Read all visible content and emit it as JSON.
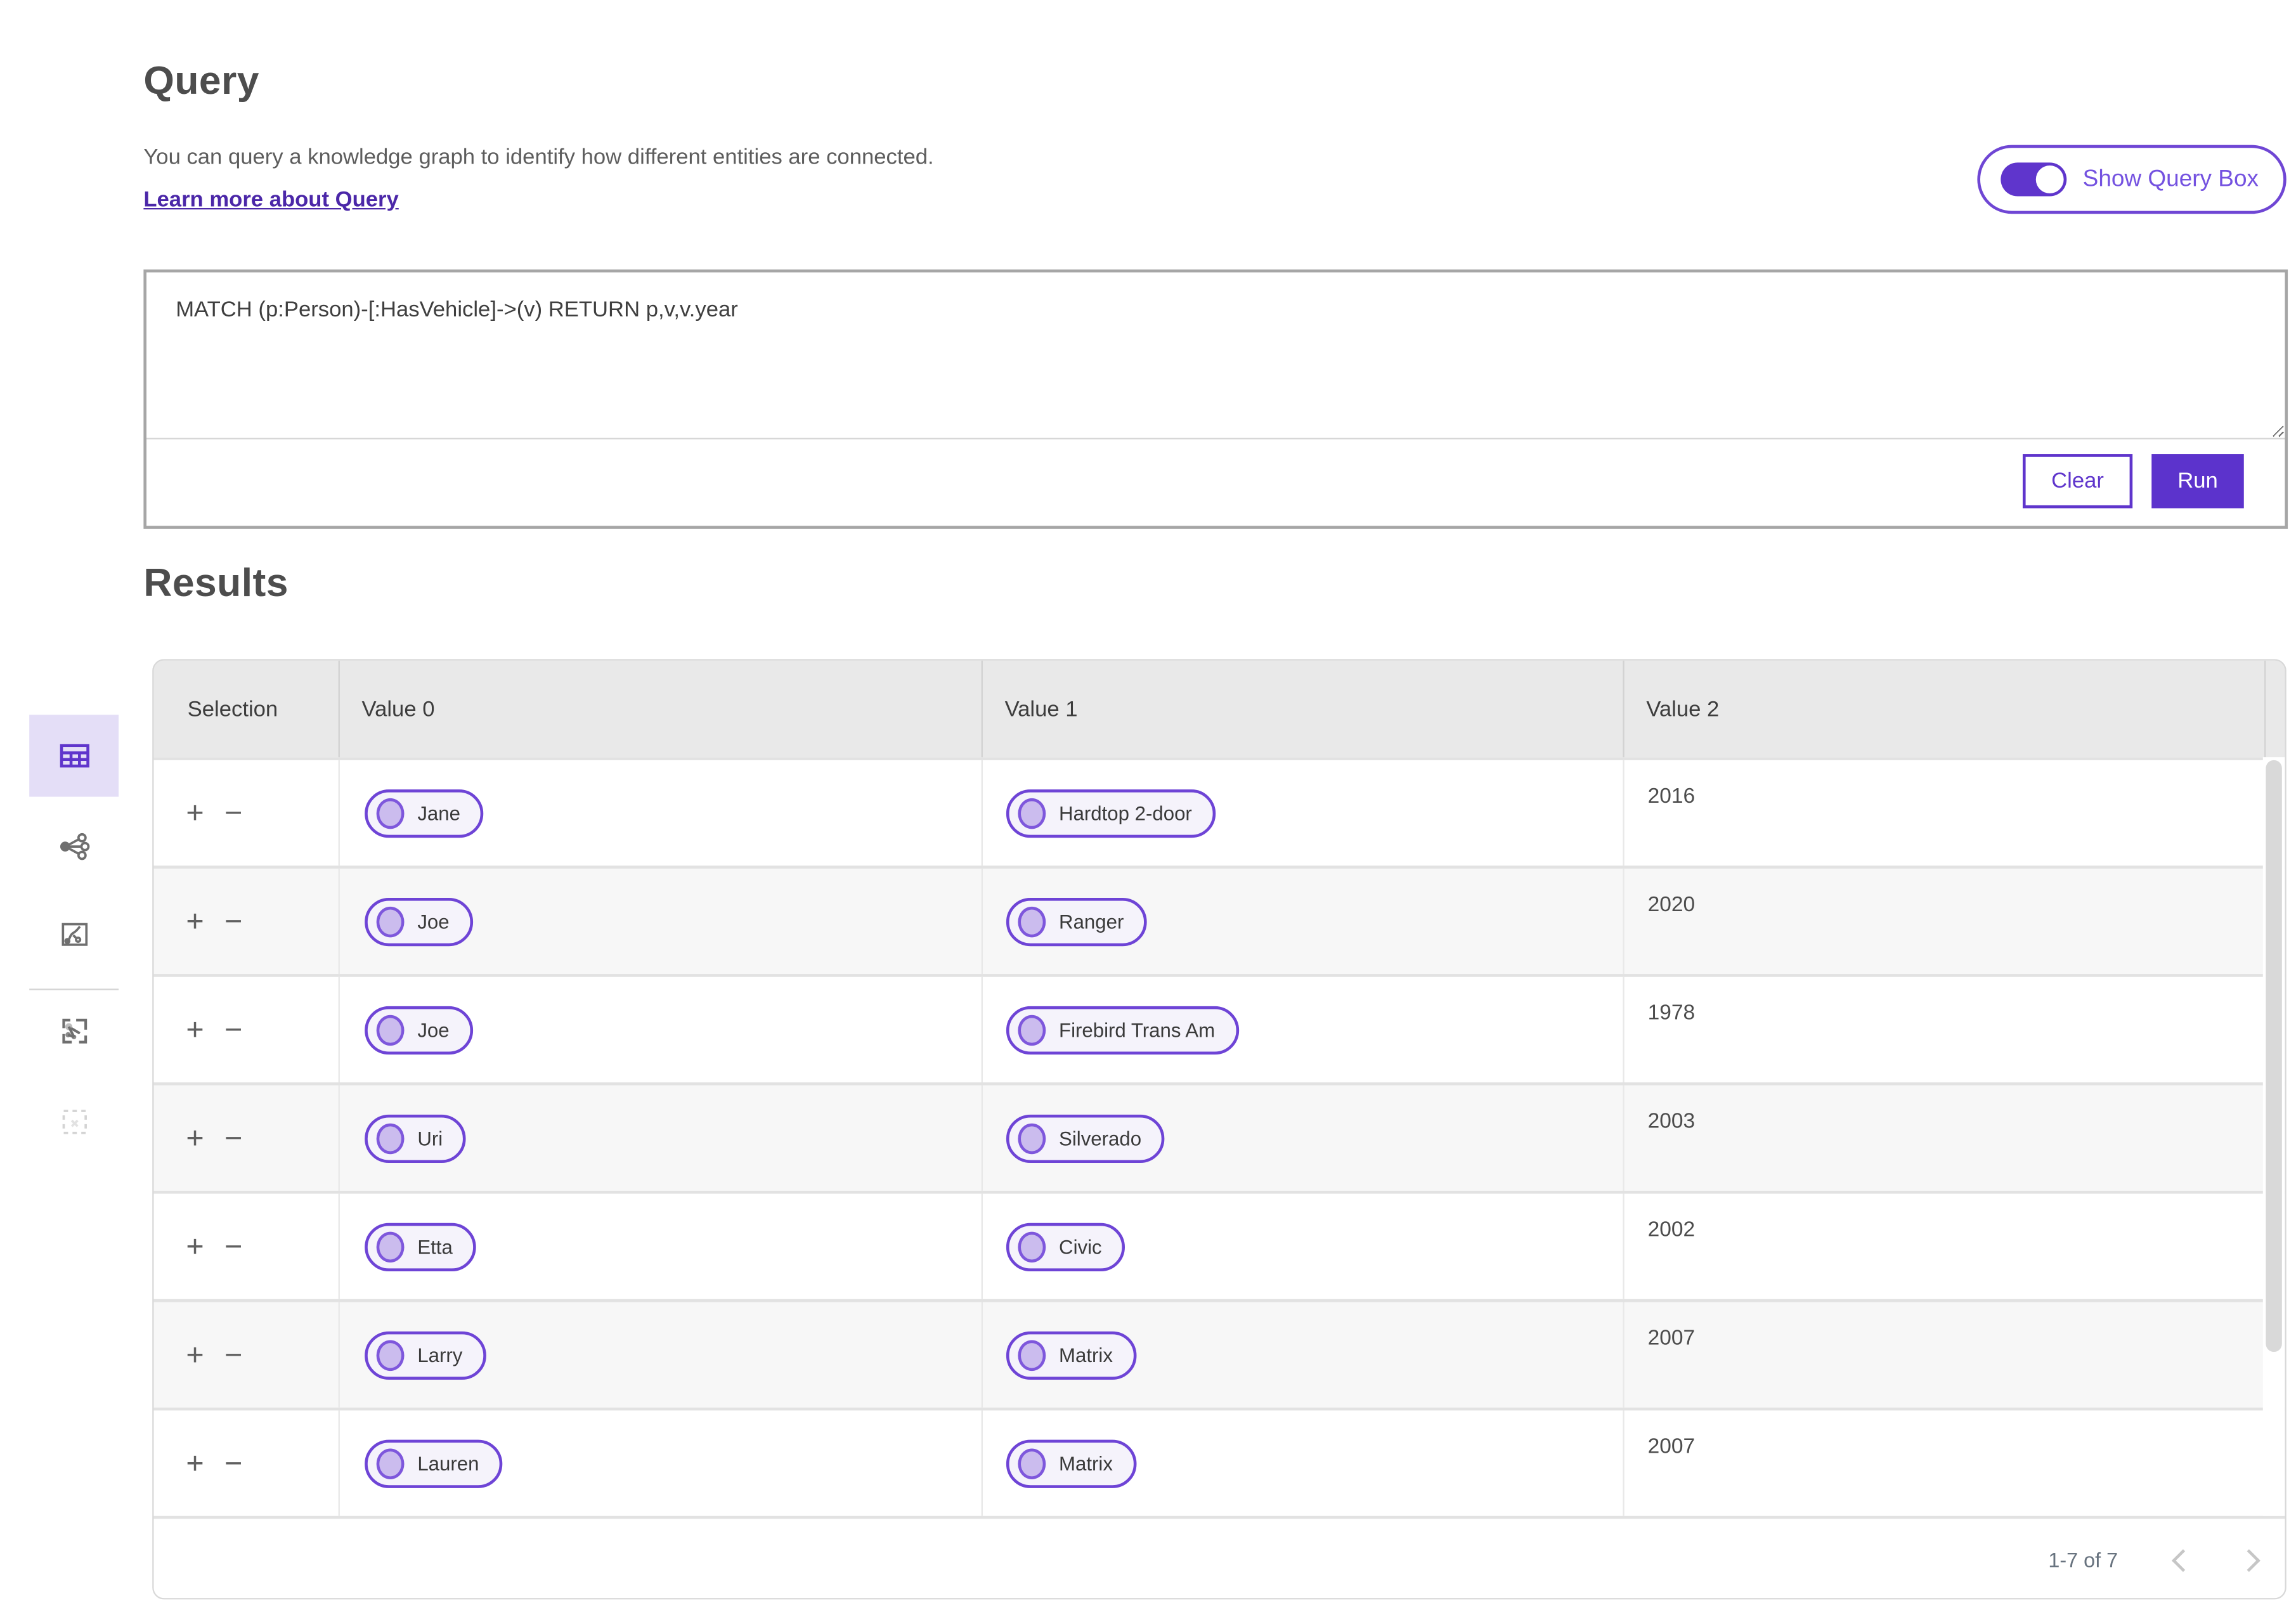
{
  "colors": {
    "accent_purple": "#5f35cc",
    "link_purple": "#4b27a8",
    "pill_border": "#6e44d6",
    "pill_fill": "#f5f3fb",
    "pill_dot_fill": "#cbbcee",
    "sidebar_selected_bg": "#e4def7",
    "table_header_gray": "#e9e9e9",
    "row_alt_gray": "#f7f7f7"
  },
  "query_section": {
    "title": "Query",
    "description": "You can query a knowledge graph to identify how different entities are connected.",
    "learn_more_link": "Learn more about Query",
    "show_query_box_label": "Show Query Box",
    "toggle_state": "on"
  },
  "query_box": {
    "query_text": "MATCH (p:Person)-[:HasVehicle]->(v) RETURN p,v,v.year",
    "clear_button": "Clear",
    "run_button": "Run"
  },
  "results_section": {
    "title": "Results",
    "columns": [
      "Selection",
      "Value 0",
      "Value 1",
      "Value 2"
    ],
    "row_actions": {
      "add": "+",
      "remove": "−"
    },
    "rows": [
      {
        "value0": "Jane",
        "value1": "Hardtop 2-door",
        "value2": "2016"
      },
      {
        "value0": "Joe",
        "value1": "Ranger",
        "value2": "2020"
      },
      {
        "value0": "Joe",
        "value1": "Firebird Trans Am",
        "value2": "1978"
      },
      {
        "value0": "Uri",
        "value1": "Silverado",
        "value2": "2003"
      },
      {
        "value0": "Etta",
        "value1": "Civic",
        "value2": "2002"
      },
      {
        "value0": "Larry",
        "value1": "Matrix",
        "value2": "2007"
      },
      {
        "value0": "Lauren",
        "value1": "Matrix",
        "value2": "2007"
      }
    ],
    "pagination": {
      "range_label": "1-7 of 7",
      "prev_icon": "chevron-left-icon",
      "next_icon": "chevron-right-icon"
    }
  },
  "sidebar": {
    "icons": [
      "table-view-icon",
      "network-graph-icon",
      "route-map-icon",
      "graph-selection-icon",
      "selection-box-icon"
    ],
    "selected": "table-view-icon"
  }
}
